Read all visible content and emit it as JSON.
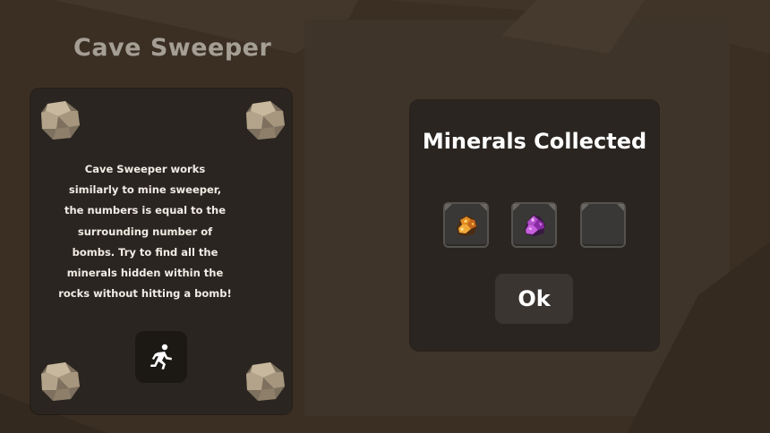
{
  "game": {
    "title": "Cave Sweeper",
    "description": "Cave Sweeper works similarly to mine sweeper, the numbers is equal to the surrounding number of bombs. Try to find all the minerals hidden within the rocks without hitting a bomb!",
    "description_lines": [
      "Cave Sweeper works",
      "similarly to mine sweeper,",
      "the numbers is equal to the",
      "surrounding number of",
      "bombs. Try to find all the",
      "minerals hidden within the",
      "rocks without hitting a bomb!"
    ],
    "exit_icon": "running-person-icon"
  },
  "results": {
    "heading": "Minerals Collected",
    "slots": [
      {
        "item": "gold-ore-icon",
        "filled": true
      },
      {
        "item": "amethyst-ore-icon",
        "filled": true
      },
      {
        "item": "",
        "filled": false
      }
    ],
    "ok_label": "Ok"
  },
  "colors": {
    "background": "#3b2f24",
    "panel": "#2a2520",
    "title_text": "#a59e94",
    "body_text": "#f1ece4",
    "button": "#3a3530"
  }
}
